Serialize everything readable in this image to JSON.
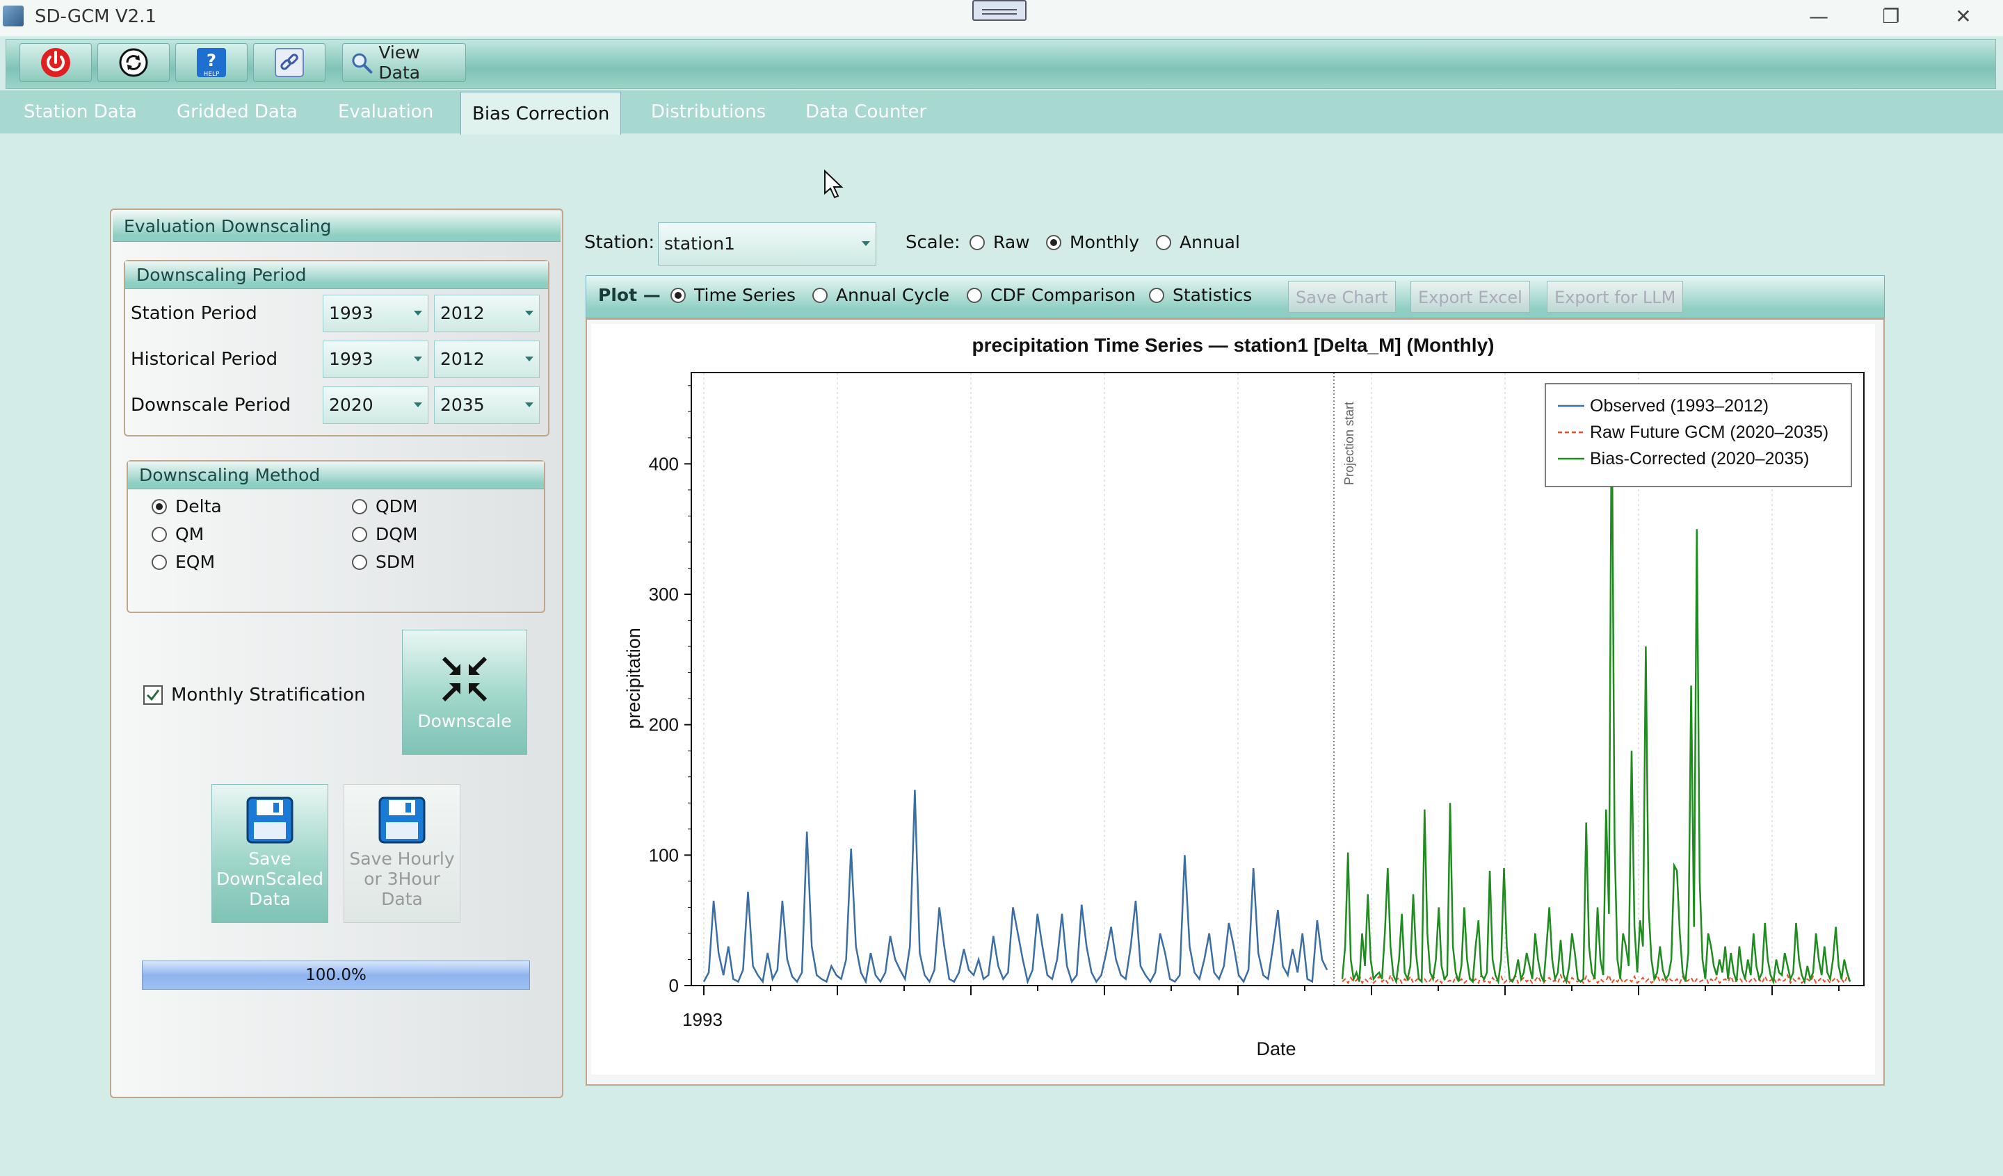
{
  "window": {
    "title": "SD-GCM V2.1",
    "controls": [
      "minimize",
      "restore",
      "close"
    ]
  },
  "toolbar": {
    "buttons": [
      {
        "name": "power-icon",
        "label": ""
      },
      {
        "name": "refresh-icon",
        "label": ""
      },
      {
        "name": "help-icon",
        "label": "HELP"
      },
      {
        "name": "link-icon",
        "label": ""
      }
    ],
    "view_data_label": "View Data"
  },
  "tabs": [
    {
      "label": "Station Data",
      "active": false
    },
    {
      "label": "Gridded Data",
      "active": false
    },
    {
      "label": "Evaluation",
      "active": false
    },
    {
      "label": "Bias Correction",
      "active": true
    },
    {
      "label": "Distributions",
      "active": false
    },
    {
      "label": "Data Counter",
      "active": false
    }
  ],
  "left_panel": {
    "title": "Evaluation Downscaling",
    "period_group": {
      "title": "Downscaling Period",
      "rows": [
        {
          "label": "Station Period",
          "from": "1993",
          "to": "2012"
        },
        {
          "label": "Historical Period",
          "from": "1993",
          "to": "2012"
        },
        {
          "label": "Downscale Period",
          "from": "2020",
          "to": "2035"
        }
      ]
    },
    "method_group": {
      "title": "Downscaling Method",
      "options": [
        {
          "label": "Delta",
          "selected": true
        },
        {
          "label": "QDM",
          "selected": false
        },
        {
          "label": "QM",
          "selected": false
        },
        {
          "label": "DQM",
          "selected": false
        },
        {
          "label": "EQM",
          "selected": false
        },
        {
          "label": "SDM",
          "selected": false
        }
      ]
    },
    "monthly_stratification": {
      "label": "Monthly Stratification",
      "checked": true
    },
    "downscale_button": "Downscale",
    "save_button": [
      "Save",
      "DownScaled",
      "Data"
    ],
    "save_hourly_button": [
      "Save Hourly",
      "or 3Hour",
      "Data"
    ],
    "progress": {
      "text": "100.0%",
      "value": 1.0
    }
  },
  "controls": {
    "station_label": "Station:",
    "station_value": "station1",
    "scale_label": "Scale:",
    "scale_options": [
      {
        "label": "Raw",
        "selected": false
      },
      {
        "label": "Monthly",
        "selected": true
      },
      {
        "label": "Annual",
        "selected": false
      }
    ],
    "plot_label": "Plot —",
    "plot_options": [
      {
        "label": "Time Series",
        "selected": true
      },
      {
        "label": "Annual Cycle",
        "selected": false
      },
      {
        "label": "CDF Comparison",
        "selected": false
      },
      {
        "label": "Statistics",
        "selected": false
      }
    ],
    "buttons": [
      "Save Chart",
      "Export Excel",
      "Export for LLM"
    ]
  },
  "colors": {
    "observed": "#3a6ea5",
    "raw_gcm": "#e8502a",
    "bias_corrected": "#1e8c1e",
    "accent": "#8fcfc3"
  },
  "chart_data": {
    "type": "line",
    "title": "precipitation Time Series — station1 [Delta_M] (Monthly)",
    "xlabel": "Date",
    "ylabel": "precipitation",
    "x_tick_label": "1993",
    "ylim": [
      0,
      470
    ],
    "yticks": [
      0,
      100,
      200,
      300,
      400
    ],
    "grid": "vertical dotted",
    "legend_position": "top-right",
    "annotation": "Projection start",
    "series": [
      {
        "name": "Observed (1993–2012)",
        "x_start": "1993-01",
        "step": "month",
        "values": [
          3,
          10,
          65,
          25,
          8,
          30,
          5,
          3,
          12,
          72,
          15,
          8,
          3,
          25,
          5,
          12,
          65,
          20,
          7,
          3,
          10,
          118,
          30,
          8,
          5,
          3,
          15,
          8,
          5,
          20,
          105,
          30,
          10,
          3,
          25,
          8,
          3,
          10,
          38,
          20,
          12,
          5,
          30,
          150,
          25,
          8,
          3,
          12,
          60,
          30,
          5,
          3,
          10,
          28,
          12,
          8,
          20,
          5,
          8,
          38,
          15,
          5,
          10,
          60,
          40,
          20,
          3,
          12,
          55,
          30,
          8,
          5,
          20,
          55,
          15,
          3,
          8,
          62,
          30,
          10,
          3,
          8,
          25,
          45,
          20,
          8,
          5,
          30,
          65,
          15,
          8,
          3,
          10,
          40,
          25,
          5,
          3,
          8,
          100,
          30,
          10,
          5,
          20,
          40,
          10,
          5,
          15,
          48,
          30,
          8,
          3,
          12,
          90,
          25,
          8,
          5,
          30,
          58,
          15,
          8,
          28,
          10,
          40,
          5,
          3,
          50,
          20,
          12
        ]
      },
      {
        "name": "Raw Future GCM (2020–2035)",
        "x_start": "2020-01",
        "step": "month",
        "values": [
          3,
          5,
          2,
          6,
          3,
          4,
          8,
          2,
          5,
          3,
          6,
          2,
          4,
          7,
          3,
          5,
          2,
          8,
          3,
          4,
          6,
          2,
          5,
          3,
          7,
          2,
          4,
          6,
          3,
          5,
          2,
          4,
          8,
          3,
          5,
          2,
          6,
          3,
          4,
          2,
          7,
          3,
          5,
          2,
          4,
          6,
          3,
          5,
          2,
          8,
          3,
          4,
          2,
          6,
          3,
          5,
          7,
          2,
          4,
          3,
          5,
          8,
          2,
          4,
          6,
          3,
          5,
          2,
          4,
          7,
          3,
          2,
          5,
          6,
          3,
          4,
          2,
          8,
          3,
          5,
          2,
          6,
          4,
          3,
          5,
          2,
          7,
          3,
          4,
          6,
          2,
          5,
          3,
          4,
          8,
          2,
          5,
          3,
          6,
          2,
          4,
          5,
          3,
          7,
          2,
          4,
          6,
          3,
          5,
          2,
          4,
          8,
          3,
          5,
          2,
          6,
          4,
          3,
          5,
          2,
          7,
          3,
          4,
          6,
          2,
          5,
          3,
          4,
          8,
          2,
          5,
          3,
          6,
          2,
          4,
          5,
          3,
          7,
          2,
          4,
          6,
          3,
          5,
          2,
          4,
          6,
          3,
          5,
          2,
          7,
          3,
          4,
          6,
          2,
          5,
          3,
          4,
          8,
          2,
          5,
          3,
          6,
          2,
          4,
          5,
          3,
          7,
          2,
          4,
          6,
          3,
          5,
          2,
          4,
          6,
          3,
          5,
          2,
          7,
          3,
          4,
          6,
          2,
          5,
          3,
          4,
          8,
          2,
          5,
          3,
          6,
          2
        ]
      },
      {
        "name": "Bias-Corrected (2020–2035)",
        "x_start": "2020-01",
        "step": "month",
        "values": [
          5,
          30,
          102,
          20,
          5,
          10,
          3,
          40,
          15,
          70,
          20,
          5,
          8,
          10,
          5,
          40,
          90,
          30,
          8,
          3,
          20,
          55,
          10,
          5,
          15,
          70,
          25,
          5,
          3,
          135,
          40,
          10,
          5,
          20,
          60,
          15,
          5,
          8,
          140,
          30,
          10,
          3,
          15,
          60,
          20,
          5,
          3,
          30,
          50,
          8,
          5,
          10,
          88,
          20,
          8,
          3,
          20,
          90,
          30,
          5,
          3,
          8,
          20,
          5,
          10,
          25,
          15,
          5,
          40,
          20,
          8,
          3,
          30,
          60,
          20,
          5,
          10,
          35,
          8,
          3,
          15,
          40,
          25,
          5,
          3,
          5,
          125,
          30,
          10,
          5,
          60,
          20,
          8,
          135,
          55,
          460,
          110,
          20,
          5,
          40,
          30,
          15,
          180,
          45,
          10,
          50,
          30,
          260,
          60,
          20,
          5,
          10,
          30,
          12,
          5,
          8,
          20,
          92,
          88,
          40,
          10,
          3,
          25,
          230,
          45,
          350,
          80,
          20,
          5,
          40,
          30,
          15,
          8,
          20,
          10,
          30,
          5,
          25,
          10,
          3,
          30,
          12,
          5,
          20,
          8,
          40,
          15,
          5,
          10,
          48,
          20,
          8,
          3,
          20,
          10,
          8,
          25,
          15,
          5,
          10,
          48,
          20,
          8,
          3,
          15,
          5,
          10,
          40,
          20,
          8,
          30,
          10,
          5,
          20,
          45,
          15,
          5,
          20,
          10,
          3
        ]
      }
    ]
  }
}
